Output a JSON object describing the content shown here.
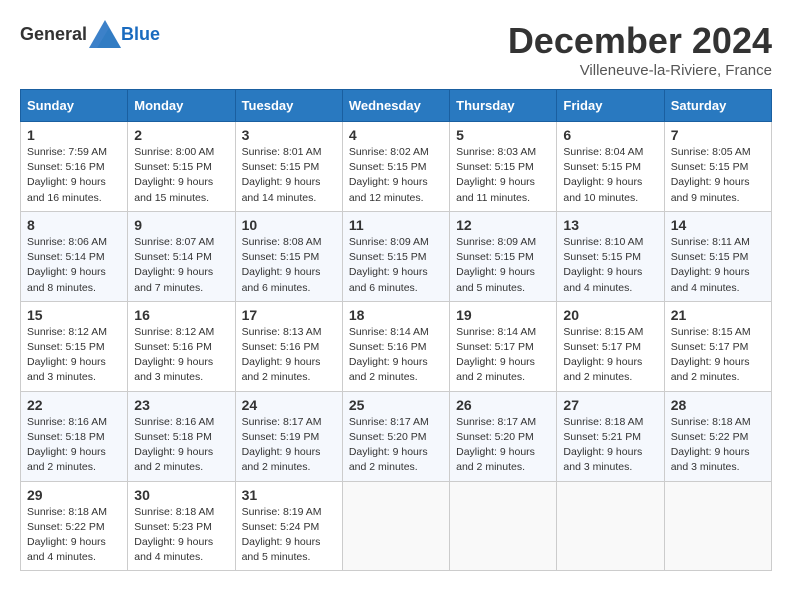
{
  "header": {
    "logo_general": "General",
    "logo_blue": "Blue",
    "title": "December 2024",
    "subtitle": "Villeneuve-la-Riviere, France"
  },
  "days_of_week": [
    "Sunday",
    "Monday",
    "Tuesday",
    "Wednesday",
    "Thursday",
    "Friday",
    "Saturday"
  ],
  "weeks": [
    [
      {
        "day": 1,
        "sunrise": "7:59 AM",
        "sunset": "5:16 PM",
        "daylight": "9 hours and 16 minutes."
      },
      {
        "day": 2,
        "sunrise": "8:00 AM",
        "sunset": "5:15 PM",
        "daylight": "9 hours and 15 minutes."
      },
      {
        "day": 3,
        "sunrise": "8:01 AM",
        "sunset": "5:15 PM",
        "daylight": "9 hours and 14 minutes."
      },
      {
        "day": 4,
        "sunrise": "8:02 AM",
        "sunset": "5:15 PM",
        "daylight": "9 hours and 12 minutes."
      },
      {
        "day": 5,
        "sunrise": "8:03 AM",
        "sunset": "5:15 PM",
        "daylight": "9 hours and 11 minutes."
      },
      {
        "day": 6,
        "sunrise": "8:04 AM",
        "sunset": "5:15 PM",
        "daylight": "9 hours and 10 minutes."
      },
      {
        "day": 7,
        "sunrise": "8:05 AM",
        "sunset": "5:15 PM",
        "daylight": "9 hours and 9 minutes."
      }
    ],
    [
      {
        "day": 8,
        "sunrise": "8:06 AM",
        "sunset": "5:14 PM",
        "daylight": "9 hours and 8 minutes."
      },
      {
        "day": 9,
        "sunrise": "8:07 AM",
        "sunset": "5:14 PM",
        "daylight": "9 hours and 7 minutes."
      },
      {
        "day": 10,
        "sunrise": "8:08 AM",
        "sunset": "5:15 PM",
        "daylight": "9 hours and 6 minutes."
      },
      {
        "day": 11,
        "sunrise": "8:09 AM",
        "sunset": "5:15 PM",
        "daylight": "9 hours and 6 minutes."
      },
      {
        "day": 12,
        "sunrise": "8:09 AM",
        "sunset": "5:15 PM",
        "daylight": "9 hours and 5 minutes."
      },
      {
        "day": 13,
        "sunrise": "8:10 AM",
        "sunset": "5:15 PM",
        "daylight": "9 hours and 4 minutes."
      },
      {
        "day": 14,
        "sunrise": "8:11 AM",
        "sunset": "5:15 PM",
        "daylight": "9 hours and 4 minutes."
      }
    ],
    [
      {
        "day": 15,
        "sunrise": "8:12 AM",
        "sunset": "5:15 PM",
        "daylight": "9 hours and 3 minutes."
      },
      {
        "day": 16,
        "sunrise": "8:12 AM",
        "sunset": "5:16 PM",
        "daylight": "9 hours and 3 minutes."
      },
      {
        "day": 17,
        "sunrise": "8:13 AM",
        "sunset": "5:16 PM",
        "daylight": "9 hours and 2 minutes."
      },
      {
        "day": 18,
        "sunrise": "8:14 AM",
        "sunset": "5:16 PM",
        "daylight": "9 hours and 2 minutes."
      },
      {
        "day": 19,
        "sunrise": "8:14 AM",
        "sunset": "5:17 PM",
        "daylight": "9 hours and 2 minutes."
      },
      {
        "day": 20,
        "sunrise": "8:15 AM",
        "sunset": "5:17 PM",
        "daylight": "9 hours and 2 minutes."
      },
      {
        "day": 21,
        "sunrise": "8:15 AM",
        "sunset": "5:17 PM",
        "daylight": "9 hours and 2 minutes."
      }
    ],
    [
      {
        "day": 22,
        "sunrise": "8:16 AM",
        "sunset": "5:18 PM",
        "daylight": "9 hours and 2 minutes."
      },
      {
        "day": 23,
        "sunrise": "8:16 AM",
        "sunset": "5:18 PM",
        "daylight": "9 hours and 2 minutes."
      },
      {
        "day": 24,
        "sunrise": "8:17 AM",
        "sunset": "5:19 PM",
        "daylight": "9 hours and 2 minutes."
      },
      {
        "day": 25,
        "sunrise": "8:17 AM",
        "sunset": "5:20 PM",
        "daylight": "9 hours and 2 minutes."
      },
      {
        "day": 26,
        "sunrise": "8:17 AM",
        "sunset": "5:20 PM",
        "daylight": "9 hours and 2 minutes."
      },
      {
        "day": 27,
        "sunrise": "8:18 AM",
        "sunset": "5:21 PM",
        "daylight": "9 hours and 3 minutes."
      },
      {
        "day": 28,
        "sunrise": "8:18 AM",
        "sunset": "5:22 PM",
        "daylight": "9 hours and 3 minutes."
      }
    ],
    [
      {
        "day": 29,
        "sunrise": "8:18 AM",
        "sunset": "5:22 PM",
        "daylight": "9 hours and 4 minutes."
      },
      {
        "day": 30,
        "sunrise": "8:18 AM",
        "sunset": "5:23 PM",
        "daylight": "9 hours and 4 minutes."
      },
      {
        "day": 31,
        "sunrise": "8:19 AM",
        "sunset": "5:24 PM",
        "daylight": "9 hours and 5 minutes."
      },
      null,
      null,
      null,
      null
    ]
  ]
}
